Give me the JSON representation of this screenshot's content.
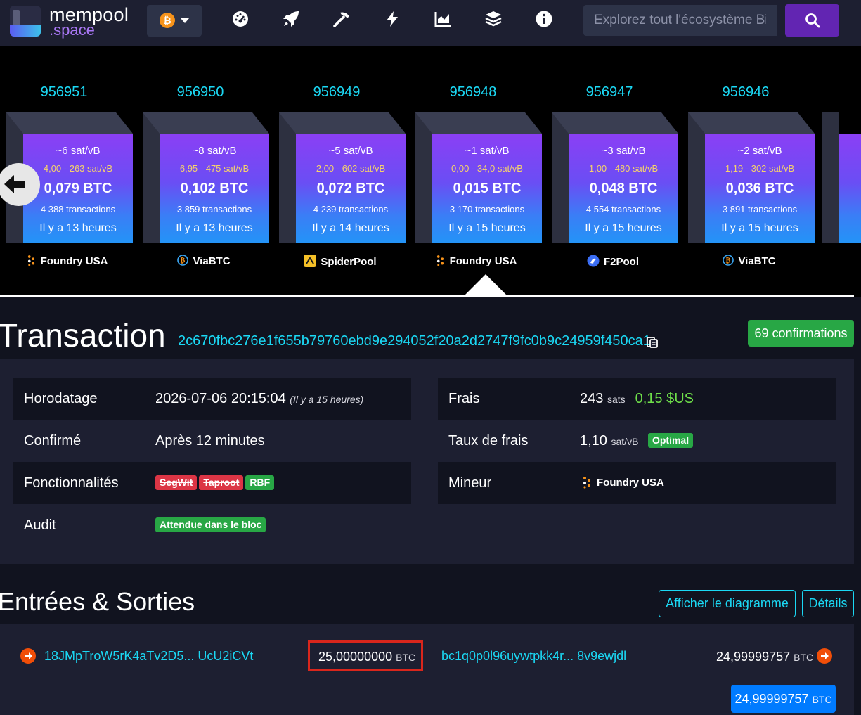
{
  "brand": {
    "line1": "mempool",
    "line2": ".space"
  },
  "network": {
    "symbol": "₿"
  },
  "nav_icons": [
    "dashboard-icon",
    "rocket-icon",
    "mining-icon",
    "lightning-icon",
    "graphs-icon",
    "layers-icon",
    "info-icon"
  ],
  "search": {
    "placeholder": "Explorez tout l'écosystème Bitcoin"
  },
  "blocks": [
    {
      "height": "956951",
      "fee": "~6 sat/vB",
      "range": "4,00 - 263 sat/vB",
      "btc": "0,079 BTC",
      "tx": "4 388 transactions",
      "time": "Il y a 13 heures",
      "pool": "Foundry USA",
      "pool_icon": "foundry-icon"
    },
    {
      "height": "956950",
      "fee": "~8 sat/vB",
      "range": "6,95 - 475 sat/vB",
      "btc": "0,102 BTC",
      "tx": "3 859 transactions",
      "time": "Il y a 13 heures",
      "pool": "ViaBTC",
      "pool_icon": "viabtc-icon"
    },
    {
      "height": "956949",
      "fee": "~5 sat/vB",
      "range": "2,00 - 602 sat/vB",
      "btc": "0,072 BTC",
      "tx": "4 239 transactions",
      "time": "Il y a 14 heures",
      "pool": "SpiderPool",
      "pool_icon": "spiderpool-icon"
    },
    {
      "height": "956948",
      "fee": "~1 sat/vB",
      "range": "0,00 - 34,0 sat/vB",
      "btc": "0,015 BTC",
      "tx": "3 170 transactions",
      "time": "Il y a 15 heures",
      "pool": "Foundry USA",
      "pool_icon": "foundry-icon"
    },
    {
      "height": "956947",
      "fee": "~3 sat/vB",
      "range": "1,00 - 480 sat/vB",
      "btc": "0,048 BTC",
      "tx": "4 554 transactions",
      "time": "Il y a 15 heures",
      "pool": "F2Pool",
      "pool_icon": "f2pool-icon"
    },
    {
      "height": "956946",
      "fee": "~2 sat/vB",
      "range": "1,19 - 302 sat/vB",
      "btc": "0,036 BTC",
      "tx": "3 891 transactions",
      "time": "Il y a 15 heures",
      "pool": "ViaBTC",
      "pool_icon": "viabtc-icon"
    }
  ],
  "transaction": {
    "title": "Transaction",
    "txid": "2c670fbc276e1f655b79760ebd9e294052f20a2d2747f9fc0b9c24959f450ca1",
    "confirmations": "69 confirmations",
    "timestamp_label": "Horodatage",
    "timestamp_value": "2026-07-06 20:15:04",
    "timestamp_relative": "(Il y a 15 heures)",
    "confirmed_label": "Confirmé",
    "confirmed_value": "Après 12 minutes",
    "features_label": "Fonctionnalités",
    "features": [
      "SegWit",
      "Taproot",
      "RBF"
    ],
    "audit_label": "Audit",
    "audit_value": "Attendue dans le bloc",
    "fee_label": "Frais",
    "fee_value": "243",
    "fee_unit": "sats",
    "fee_usd": "0,15 $US",
    "feerate_label": "Taux de frais",
    "feerate_value": "1,10",
    "feerate_unit": "sat/vB",
    "feerate_badge": "Optimal",
    "miner_label": "Mineur",
    "miner_value": "Foundry USA"
  },
  "io": {
    "title": "Entrées & Sorties",
    "diagram_button": "Afficher le diagramme",
    "details_button": "Détails",
    "input_address": "18JMpTroW5rK4aTv2D5... UcU2iCVt",
    "input_amount": "25,00000000",
    "input_unit": "BTC",
    "output_address": "bc1q0p0l96uywtpkk4r... 8v9ewjdl",
    "output_amount": "24,99999757",
    "output_unit": "BTC",
    "total_amount": "24,99999757",
    "total_unit": "BTC"
  },
  "colors": {
    "accent": "#1bd8f4",
    "purple": "#6225b2",
    "success": "#28a745",
    "danger": "#dc3545",
    "output_arrow": "#f14e08"
  }
}
